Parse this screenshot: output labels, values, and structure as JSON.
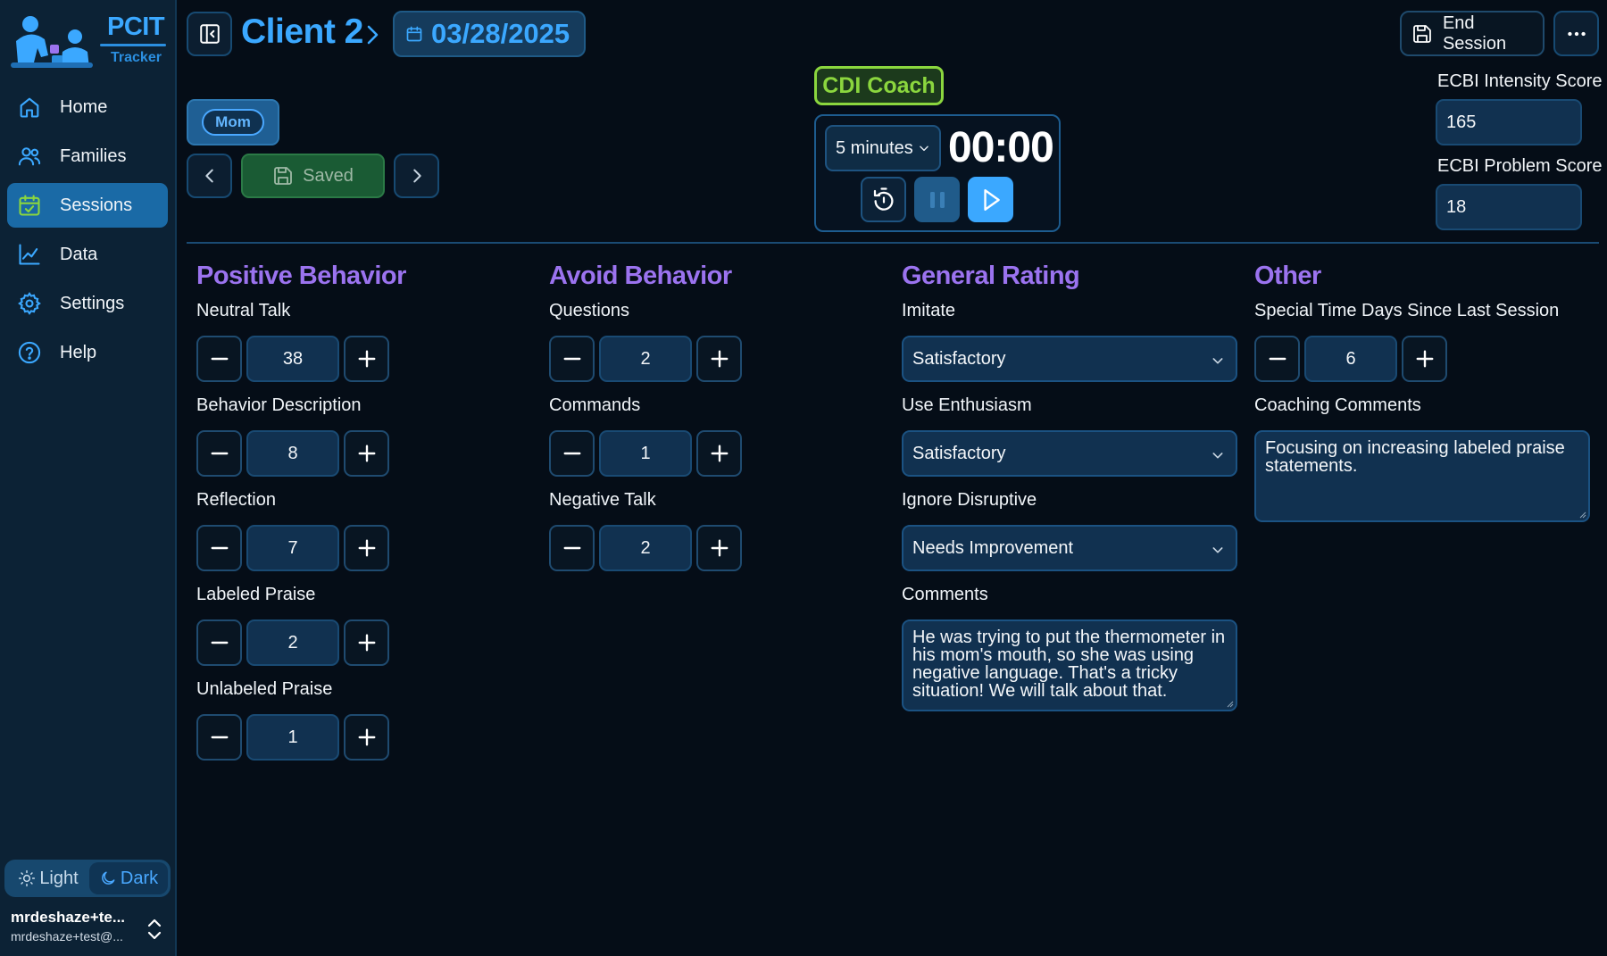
{
  "app": {
    "logo_title": "PCIT",
    "logo_subtitle": "Tracker"
  },
  "sidebar": {
    "items": [
      {
        "label": "Home",
        "icon": "home-icon",
        "active": false
      },
      {
        "label": "Families",
        "icon": "users-icon",
        "active": false
      },
      {
        "label": "Sessions",
        "icon": "calendar-check-icon",
        "active": true
      },
      {
        "label": "Data",
        "icon": "line-chart-icon",
        "active": false
      },
      {
        "label": "Settings",
        "icon": "gear-icon",
        "active": false
      },
      {
        "label": "Help",
        "icon": "help-circle-icon",
        "active": false
      }
    ],
    "theme": {
      "light_label": "Light",
      "dark_label": "Dark",
      "selected": "Dark"
    },
    "user": {
      "name": "mrdeshaze+te...",
      "email": "mrdeshaze+test@..."
    }
  },
  "header": {
    "client_name": "Client 2",
    "session_date": "03/28/2025",
    "end_session_label": "End Session"
  },
  "session": {
    "parent_label": "Mom",
    "saved_label": "Saved",
    "coach_mode": "CDI Coach"
  },
  "timer": {
    "duration": "5 minutes",
    "readout": "00:00"
  },
  "ecbi": {
    "intensity_label": "ECBI Intensity Score",
    "intensity_value": "165",
    "problem_label": "ECBI Problem Score",
    "problem_value": "18"
  },
  "positive": {
    "title": "Positive Behavior",
    "items": [
      {
        "label": "Neutral Talk",
        "value": "38"
      },
      {
        "label": "Behavior Description",
        "value": "8"
      },
      {
        "label": "Reflection",
        "value": "7"
      },
      {
        "label": "Labeled Praise",
        "value": "2"
      },
      {
        "label": "Unlabeled Praise",
        "value": "1"
      }
    ]
  },
  "avoid": {
    "title": "Avoid Behavior",
    "items": [
      {
        "label": "Questions",
        "value": "2"
      },
      {
        "label": "Commands",
        "value": "1"
      },
      {
        "label": "Negative Talk",
        "value": "2"
      }
    ]
  },
  "general": {
    "title": "General Rating",
    "ratings": [
      {
        "label": "Imitate",
        "value": "Satisfactory"
      },
      {
        "label": "Use Enthusiasm",
        "value": "Satisfactory"
      },
      {
        "label": "Ignore Disruptive",
        "value": "Needs Improvement"
      }
    ],
    "comments_label": "Comments",
    "comments_value": "He was trying to put the thermometer in his mom's mouth, so she was using negative language. That's a tricky situation! We will talk about that."
  },
  "other": {
    "title": "Other",
    "special_time_label": "Special Time Days Since Last Session",
    "special_time_value": "6",
    "coaching_label": "Coaching Comments",
    "coaching_value": "Focusing on increasing labeled praise statements."
  },
  "colors": {
    "accent_blue": "#3ba8ff",
    "section_purple": "#9b73ef",
    "coach_green": "#8bd63e",
    "background": "#050d17",
    "sidebar": "#0c2235"
  }
}
